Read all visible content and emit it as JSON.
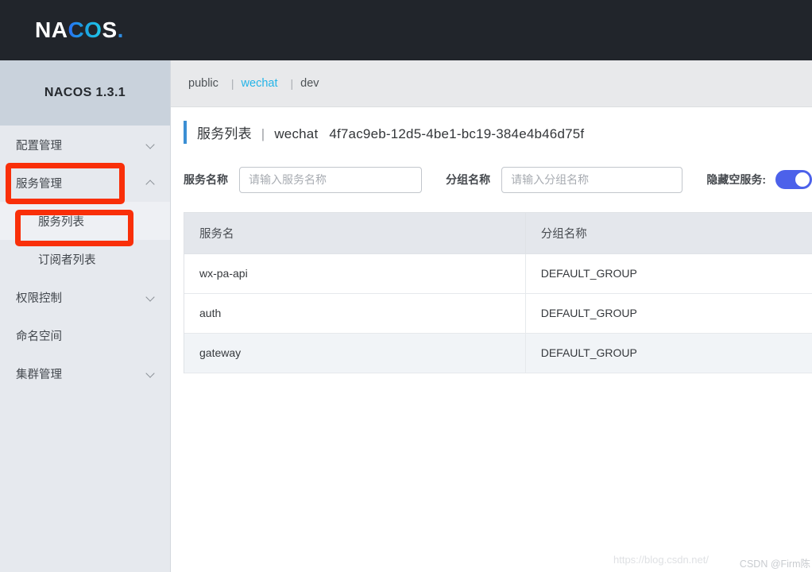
{
  "header": {
    "logo_na": "NA",
    "logo_co": "CO",
    "logo_s": "S",
    "logo_dot": ".",
    "logo_alt": "NACOS.",
    "bg_color": "#21252b"
  },
  "sidebar": {
    "version_title": "NACOS 1.3.1",
    "items": [
      {
        "label": "配置管理",
        "icon": "chevron-down-icon",
        "expandable": true,
        "level": 0
      },
      {
        "label": "服务管理",
        "icon": "chevron-up-icon",
        "expandable": true,
        "level": 0
      },
      {
        "label": "服务列表",
        "icon": "",
        "expandable": false,
        "level": 1,
        "active": true
      },
      {
        "label": "订阅者列表",
        "icon": "",
        "expandable": false,
        "level": 1
      },
      {
        "label": "权限控制",
        "icon": "chevron-down-icon",
        "expandable": true,
        "level": 0
      },
      {
        "label": "命名空间",
        "icon": "",
        "expandable": false,
        "level": 0
      },
      {
        "label": "集群管理",
        "icon": "chevron-down-icon",
        "expandable": true,
        "level": 0
      }
    ]
  },
  "annotations": {
    "color": "#f92f09",
    "boxes": [
      {
        "target": "服务管理"
      },
      {
        "target": "服务列表"
      }
    ]
  },
  "namespace_bar": {
    "tabs": [
      {
        "label": "public",
        "active": false
      },
      {
        "label": "wechat",
        "active": true
      },
      {
        "label": "dev",
        "active": false
      }
    ],
    "separator": "|",
    "active_color": "#23b4e8"
  },
  "page": {
    "title": "服务列表",
    "title_separator": "|",
    "namespace_name": "wechat",
    "namespace_id": "4f7ac9eb-12d5-4be1-bc19-384e4b46d75f",
    "accent_color": "#3b8fd4"
  },
  "search": {
    "service_name_label": "服务名称",
    "service_name_value": "",
    "service_name_placeholder": "请输入服务名称",
    "group_name_label": "分组名称",
    "group_name_value": "",
    "group_name_placeholder": "请输入分组名称",
    "hide_empty_label": "隐藏空服务:",
    "hide_empty_on": true,
    "toggle_color": "#4c61ea"
  },
  "table": {
    "columns": [
      "服务名",
      "分组名称",
      ""
    ],
    "rows": [
      {
        "service_name": "wx-pa-api",
        "group_name": "DEFAULT_GROUP",
        "extra": ""
      },
      {
        "service_name": "auth",
        "group_name": "DEFAULT_GROUP",
        "extra": ""
      },
      {
        "service_name": "gateway",
        "group_name": "DEFAULT_GROUP",
        "extra": ""
      }
    ]
  },
  "watermark": {
    "url": "https://blog.csdn.net/",
    "user": "CSDN @Firm陈"
  }
}
